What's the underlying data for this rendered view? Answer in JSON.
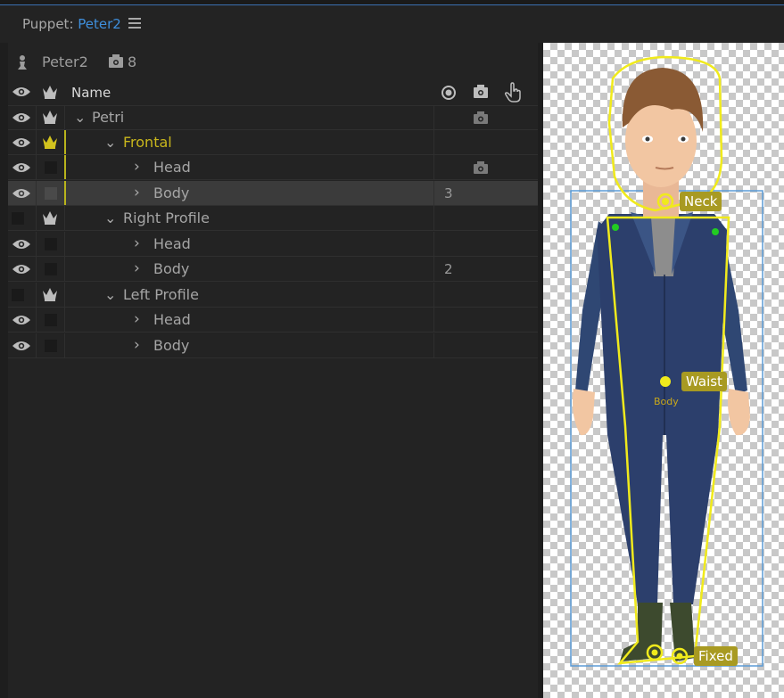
{
  "panel": {
    "title_prefix": "Puppet: ",
    "puppet_name": "Peter2"
  },
  "puppet_info": {
    "name": "Peter2",
    "camera_count": "8"
  },
  "columns": {
    "name": "Name"
  },
  "rows": [
    {
      "label": "Petri",
      "expand": "⌄",
      "num": ""
    },
    {
      "label": "Frontal",
      "expand": "⌄",
      "num": ""
    },
    {
      "label": "Head",
      "expand": "›",
      "num": ""
    },
    {
      "label": "Body",
      "expand": "›",
      "num": "3"
    },
    {
      "label": "Right Profile",
      "expand": "⌄",
      "num": ""
    },
    {
      "label": "Head",
      "expand": "›",
      "num": ""
    },
    {
      "label": "Body",
      "expand": "›",
      "num": "2"
    },
    {
      "label": "Left Profile",
      "expand": "⌄",
      "num": ""
    },
    {
      "label": "Head",
      "expand": "›",
      "num": ""
    },
    {
      "label": "Body",
      "expand": "›",
      "num": ""
    }
  ],
  "handles": {
    "neck": "Neck",
    "waist": "Waist",
    "body": "Body",
    "fixed": "Fixed"
  },
  "colors": {
    "accent_blue": "#3f8fdc",
    "active_yellow": "#c8b61c",
    "handle_tag": "#a89a22",
    "outline_yellow": "#f0ea1c",
    "bounds_blue": "#5b9bd5"
  }
}
